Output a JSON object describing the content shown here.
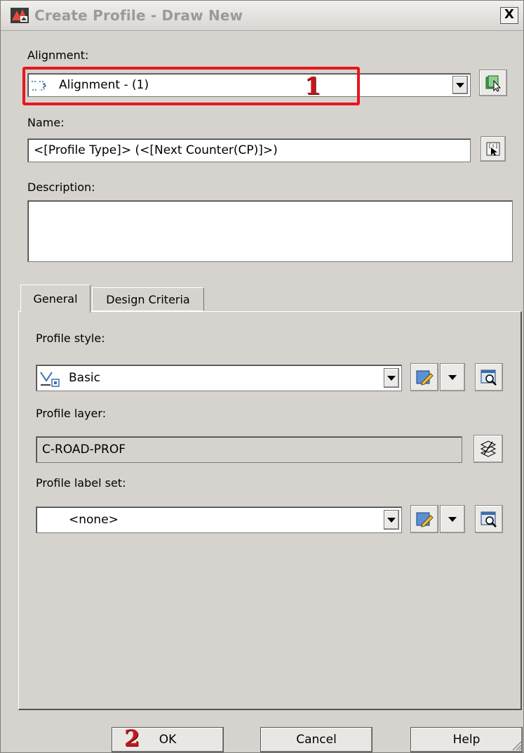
{
  "window": {
    "title": "Create Profile - Draw New",
    "close_glyph": "X"
  },
  "alignment": {
    "label": "Alignment:",
    "value": "Alignment - (1)",
    "icon": "alignment-icon"
  },
  "name": {
    "label": "Name:",
    "value": "<[Profile Type]> (<[Next Counter(CP)]>)"
  },
  "description": {
    "label": "Description:",
    "value": ""
  },
  "tabs": [
    {
      "label": "General",
      "active": true
    },
    {
      "label": "Design Criteria",
      "active": false
    }
  ],
  "general": {
    "profile_style": {
      "label": "Profile style:",
      "value": "Basic"
    },
    "profile_layer": {
      "label": "Profile layer:",
      "value": "C-ROAD-PROF"
    },
    "profile_label_set": {
      "label": "Profile label set:",
      "value": "<none>"
    }
  },
  "buttons": {
    "ok": "OK",
    "cancel": "Cancel",
    "help": "Help"
  },
  "annotations": {
    "callout_1": "1",
    "callout_2": "2"
  },
  "colors": {
    "annotation_red": "#e8161d",
    "dialog_bg": "#d6d3ce"
  }
}
